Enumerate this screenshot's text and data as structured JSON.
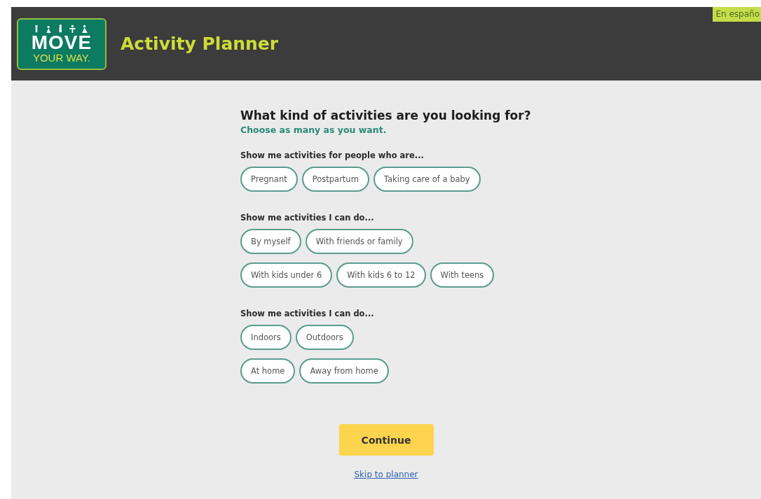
{
  "header": {
    "logo": {
      "line_1": "MOVE",
      "line_2": "YOUR WAY."
    },
    "title": "Activity Planner",
    "language_link": "En españo"
  },
  "question": {
    "title": "What kind of activities are you looking for?",
    "subtitle": "Choose as many as you want."
  },
  "groups": [
    {
      "label": "Show me activities for people who are...",
      "rows": [
        [
          {
            "label": "Pregnant",
            "selected": false
          },
          {
            "label": "Postpartum",
            "selected": false
          },
          {
            "label": "Taking care of a baby",
            "selected": false
          }
        ]
      ]
    },
    {
      "label": "Show me activities I can do...",
      "rows": [
        [
          {
            "label": "By myself",
            "selected": false
          },
          {
            "label": "With friends or family",
            "selected": false
          }
        ],
        [
          {
            "label": "With kids under 6",
            "selected": false
          },
          {
            "label": "With kids 6 to 12",
            "selected": false
          },
          {
            "label": "With teens",
            "selected": false
          }
        ]
      ]
    },
    {
      "label": "Show me activities I can do...",
      "rows": [
        [
          {
            "label": "Indoors",
            "selected": false
          },
          {
            "label": "Outdoors",
            "selected": false
          }
        ],
        [
          {
            "label": "At home",
            "selected": false
          },
          {
            "label": "Away from home",
            "selected": false
          }
        ]
      ]
    }
  ],
  "continue_button": "Continue",
  "skip_link": "Skip to planner"
}
